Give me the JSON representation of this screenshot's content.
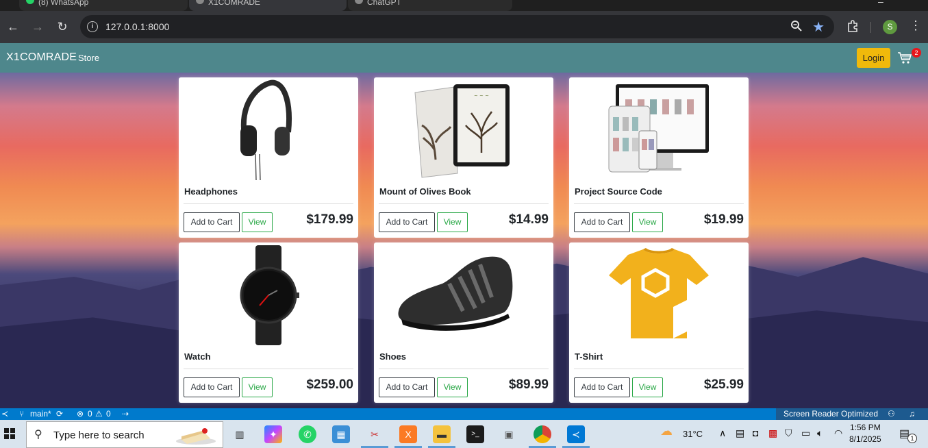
{
  "browser": {
    "tabs": [
      {
        "label": "(8) WhatsApp"
      },
      {
        "label": "X1COMRADE"
      },
      {
        "label": "ChatGPT"
      }
    ],
    "url": "127.0.0.1:8000",
    "profile_initial": "S"
  },
  "site": {
    "brand": "X1COMRADE",
    "nav_link": "Store",
    "login_label": "Login",
    "cart_count": "2"
  },
  "products": [
    {
      "name": "Headphones",
      "add_label": "Add to Cart",
      "view_label": "View",
      "price": "$179.99"
    },
    {
      "name": "Mount of Olives Book",
      "add_label": "Add to Cart",
      "view_label": "View",
      "price": "$14.99"
    },
    {
      "name": "Project Source Code",
      "add_label": "Add to Cart",
      "view_label": "View",
      "price": "$19.99"
    },
    {
      "name": "Watch",
      "add_label": "Add to Cart",
      "view_label": "View",
      "price": "$259.00"
    },
    {
      "name": "Shoes",
      "add_label": "Add to Cart",
      "view_label": "View",
      "price": "$89.99"
    },
    {
      "name": "T-Shirt",
      "add_label": "Add to Cart",
      "view_label": "View",
      "price": "$25.99"
    }
  ],
  "statusbar": {
    "branch": "main*",
    "errors": "0",
    "warnings": "0",
    "screen_reader": "Screen Reader Optimized"
  },
  "taskbar": {
    "search_placeholder": "Type here to search",
    "temperature": "31°C",
    "time": "1:56 PM",
    "date": "8/1/2025",
    "notification_count": "1"
  }
}
